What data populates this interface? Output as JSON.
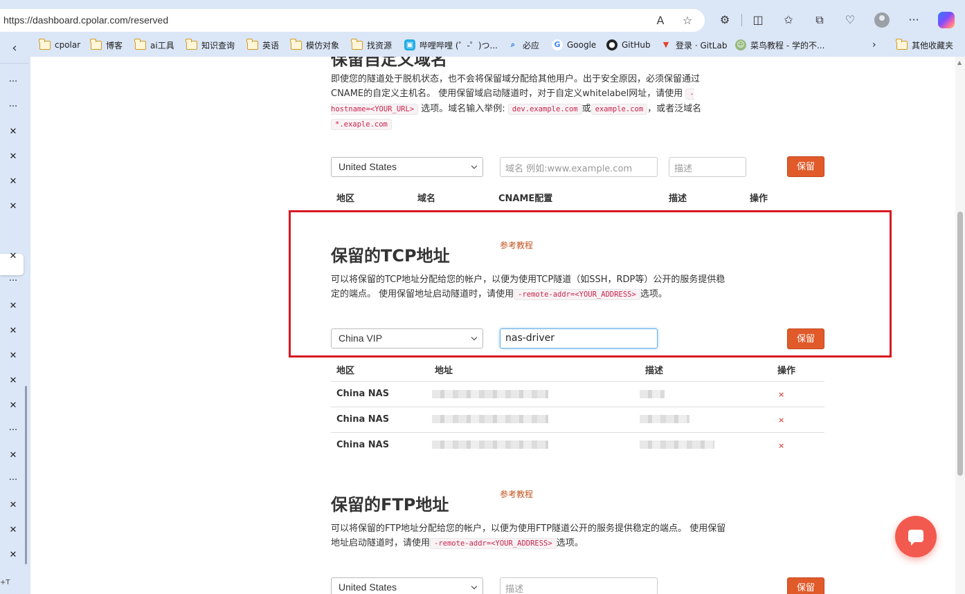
{
  "browser": {
    "url": "https://dashboard.cpolar.com/reserved",
    "bookmarks": [
      "cpolar",
      "博客",
      "ai工具",
      "知识查询",
      "英语",
      "模仿对象",
      "找资源",
      "哔哩哔哩 (゜-゜)つ...",
      "必应",
      "Google",
      "GitHub",
      "登录 · GitLab",
      "菜鸟教程 - 学的不...",
      "其他收藏夹"
    ],
    "read_aloud": "A",
    "more": "···",
    "shortcut": "+T"
  },
  "domain_section": {
    "title": "保留自定义域名",
    "desc_1": "即使您的隧道处于脱机状态，也不会将保留域分配给其他用户。出于安全原因，必须保留通过CNAME的自定义主机名。 使用保留域启动隧道时，对于自定义whitelabel网址，请使用",
    "code_hostname": "-hostname=<YOUR_URL>",
    "desc_2": "选项。域名输入举例:",
    "code_ex1": "dev.example.com",
    "desc_3": "或",
    "code_ex2": "example.com",
    "desc_4": "，或者泛域名",
    "code_ex3": "*.exaple.com",
    "region_selected": "United States",
    "domain_placeholder": "域名 例如:www.example.com",
    "desc_placeholder": "描述",
    "save": "保留",
    "cols": [
      "地区",
      "域名",
      "CNAME配置",
      "描述",
      "操作"
    ]
  },
  "tcp_section": {
    "title": "保留的TCP地址",
    "ref": "参考教程",
    "desc_1": "可以将保留的TCP地址分配给您的帐户，以便为使用TCP隧道（如SSH，RDP等）公开的服务提供稳定的端点。 使用保留地址启动隧道时，请使用",
    "code": "-remote-addr=<YOUR_ADDRESS>",
    "desc_2": "选项。",
    "region_selected": "China VIP",
    "desc_value": "nas-driver",
    "save": "保留",
    "cols": [
      "地区",
      "地址",
      "描述",
      "操作"
    ],
    "rows": [
      {
        "region": "China NAS",
        "delete": "×"
      },
      {
        "region": "China NAS",
        "delete": "×"
      },
      {
        "region": "China NAS",
        "delete": "×"
      }
    ]
  },
  "ftp_section": {
    "title": "保留的FTP地址",
    "ref": "参考教程",
    "desc_1": "可以将保留的FTP地址分配给您的帐户，以便为使用FTP隧道公开的服务提供稳定的端点。 使用保留地址启动隧道时，请使用",
    "code": "-remote-addr=<YOUR_ADDRESS>",
    "desc_2": "选项。",
    "region_selected": "United States",
    "desc_placeholder": "描述",
    "save": "保留"
  },
  "colors": {
    "accent": "#e05a2a",
    "highlight": "#d71920",
    "chat": "#f35a4f"
  }
}
